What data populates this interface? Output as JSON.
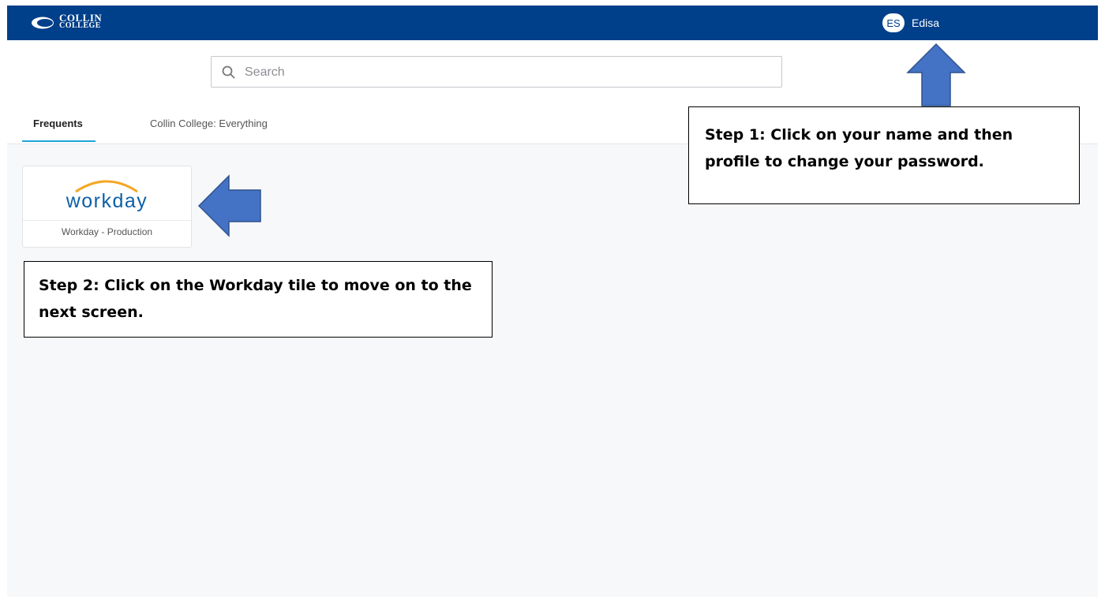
{
  "header": {
    "logo_line1": "COLLIN",
    "logo_line2": "COLLEGE",
    "user_initials": "ES",
    "user_name": "Edisa",
    "brand_color": "#003f8a"
  },
  "search": {
    "placeholder": "Search",
    "value": ""
  },
  "tabs": [
    {
      "label": "Frequents",
      "active": true
    },
    {
      "label": "Collin College: Everything",
      "active": false
    }
  ],
  "apps": [
    {
      "logo_text": "workday",
      "label": "Workday - Production"
    }
  ],
  "annotations": {
    "step1": "Step 1: Click on your name and then profile to change your password.",
    "step2": "Step 2: Click on the Workday tile to move on to the next screen.",
    "arrow_color": "#4472c4"
  }
}
